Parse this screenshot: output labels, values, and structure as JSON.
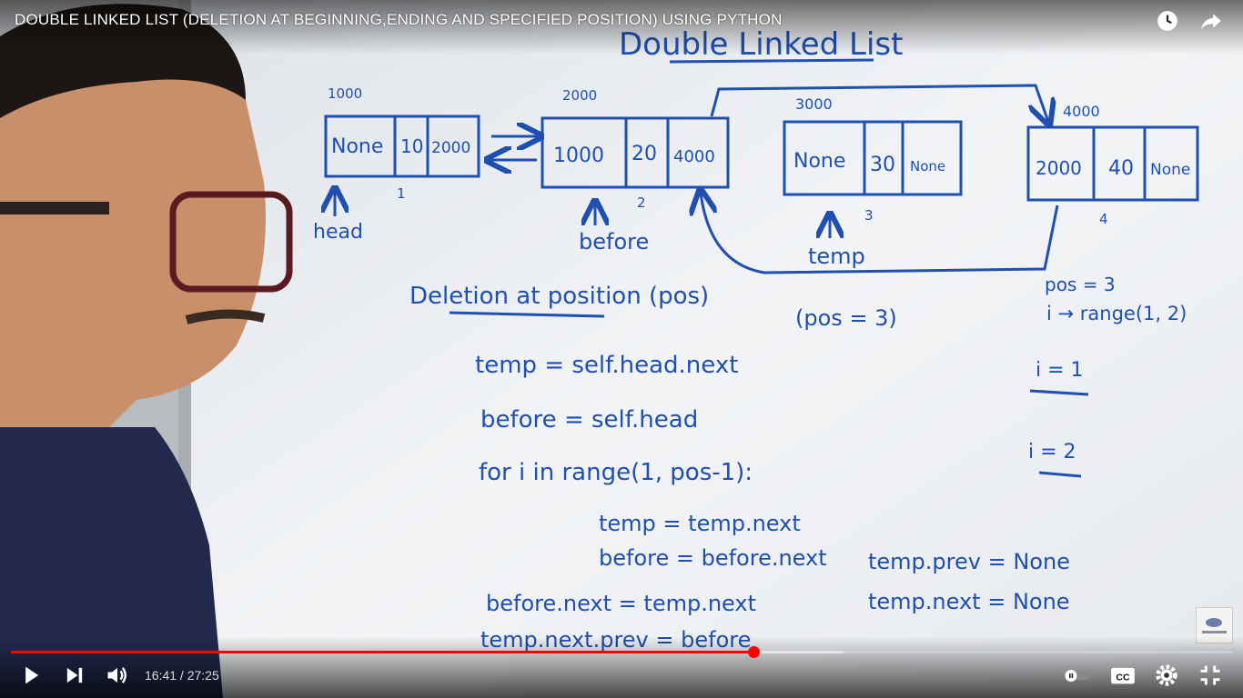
{
  "video": {
    "title": "DOUBLE LINKED LIST (DELETION AT BEGINNING,ENDING AND SPECIFIED POSITION) USING PYTHON",
    "current_time": "16:41",
    "separator": " / ",
    "duration": "27:25",
    "progress": 0.608,
    "buffered": 0.682
  },
  "board": {
    "heading": "Double Linked List",
    "nodes": [
      {
        "address": "1000",
        "prev": "None",
        "data": "10",
        "next": "2000",
        "index": "1"
      },
      {
        "address": "2000",
        "prev": "1000",
        "data": "20",
        "next": "4000",
        "index": "2"
      },
      {
        "address": "3000",
        "prev": "None",
        "data": "30",
        "next": "None",
        "index": "3"
      },
      {
        "address": "4000",
        "prev": "2000",
        "data": "40",
        "next": "None",
        "index": "4"
      }
    ],
    "pointer_head": "head",
    "pointer_before": "before",
    "pointer_temp": "temp",
    "section_title": "Deletion at position (pos)",
    "pos_note": "(pos = 3)",
    "side_notes": [
      "pos = 3",
      "i → range(1, 2)",
      "i = 1",
      "i = 2"
    ],
    "code": {
      "line1": "temp = self.head.next",
      "line2": "before = self.head",
      "line3": "for i in range(1, pos-1):",
      "line4": "temp = temp.next",
      "line5": "before = before.next",
      "line6": "before.next = temp.next",
      "line7": "temp.next.prev = before",
      "right1": "temp.prev = None",
      "right2": "temp.next = None"
    }
  },
  "icons": {
    "watch_later": "clock-icon",
    "share": "share-arrow-icon",
    "play": "play-icon",
    "next": "skip-next-icon",
    "volume": "volume-icon",
    "autoplay": "autoplay-toggle-icon",
    "captions": "cc-icon",
    "settings": "gear-icon",
    "exit_fullscreen": "exit-fullscreen-icon"
  },
  "colors": {
    "progress_played": "#ff0000",
    "marker_ink": "#1f4fb0",
    "board": "#eef0f3"
  }
}
